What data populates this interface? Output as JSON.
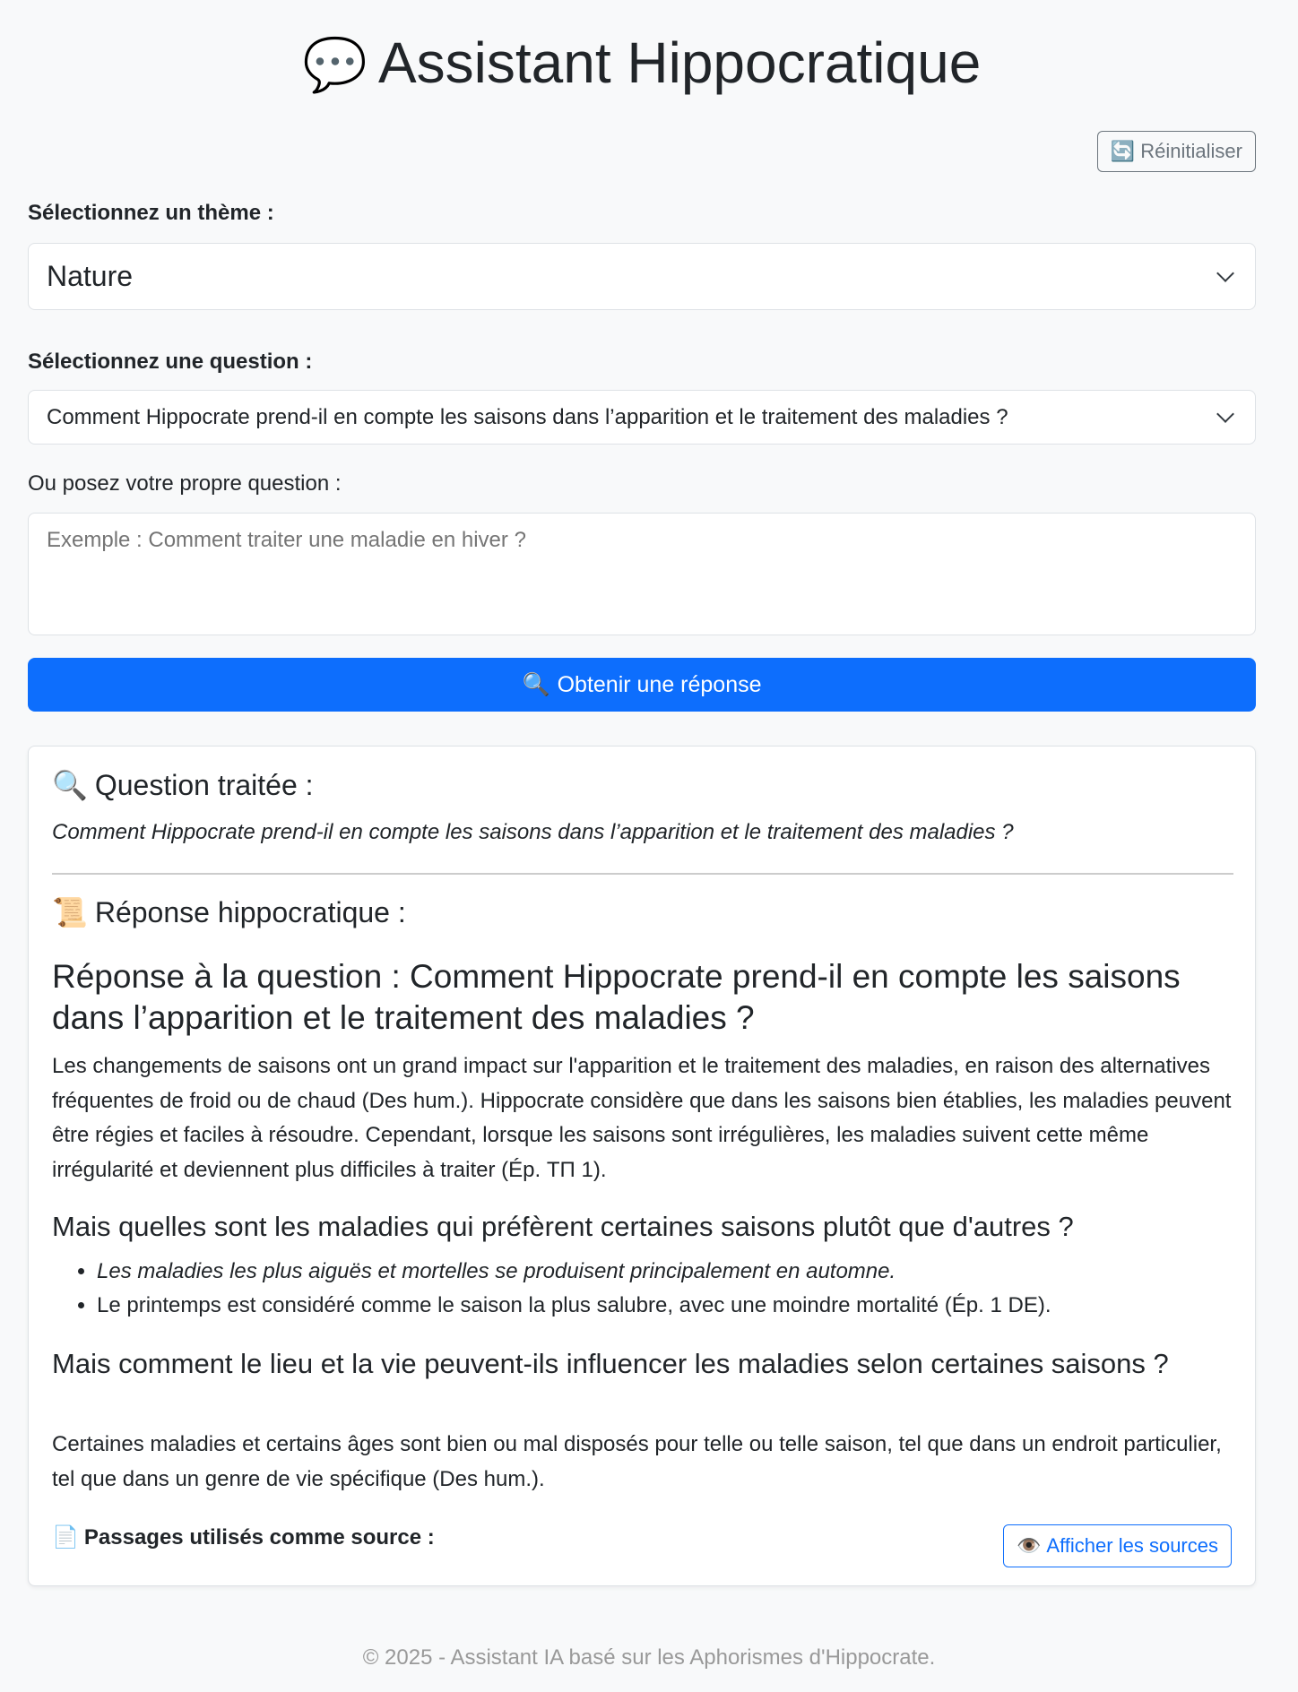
{
  "header": {
    "title_icon": "💬",
    "title": "Assistant Hippocratique",
    "reset_icon": "🔄",
    "reset_label": "Réinitialiser"
  },
  "form": {
    "theme_label": "Sélectionnez un thème :",
    "theme_selected": "Nature",
    "question_label": "Sélectionnez une question :",
    "question_selected": "Comment Hippocrate prend-il en compte les saisons dans l’apparition et le traitement des maladies ?",
    "custom_label": "Ou posez votre propre question :",
    "custom_placeholder": "Exemple : Comment traiter une maladie en hiver ?",
    "submit_icon": "🔍",
    "submit_label": "Obtenir une réponse"
  },
  "result": {
    "question_icon": "🔍",
    "question_heading": "Question traitée :",
    "question_text": "Comment Hippocrate prend-il en compte les saisons dans l’apparition et le traitement des maladies ?",
    "response_icon": "📜",
    "response_heading": "Réponse hippocratique :",
    "answer_title": "Réponse à la question : Comment Hippocrate prend-il en compte les saisons dans l’apparition et le traitement des maladies ?",
    "answer_paragraph_1": "Les changements de saisons ont un grand impact sur l'apparition et le traitement des maladies, en raison des alternatives fréquentes de froid ou de chaud (Des hum.). Hippocrate considère que dans les saisons bien établies, les maladies peuvent être régies et faciles à résoudre. Cependant, lorsque les saisons sont irrégulières, les maladies suivent cette même irrégularité et deviennent plus difficiles à traiter (Ép. ΤΠ 1).",
    "subheading_1": "Mais quelles sont les maladies qui préfèrent certaines saisons plutôt que d'autres ?",
    "list_item_1": "Les maladies les plus aiguës et mortelles se produisent principalement en automne.",
    "list_item_2": "Le printemps est considéré comme le saison la plus salubre, avec une moindre mortalité (Ép. 1 DE).",
    "subheading_2": "Mais comment le lieu et la vie peuvent-ils influencer les maladies selon certaines saisons ?",
    "answer_paragraph_2": "Certaines maladies et certains âges sont bien ou mal disposés pour telle ou telle saison, tel que dans un endroit particulier, tel que dans un genre de vie spécifique (Des hum.).",
    "sources_icon": "📄",
    "sources_label": "Passages utilisés comme source :",
    "show_sources_icon": "👁️",
    "show_sources_label": "Afficher les sources"
  },
  "footer": {
    "text": "© 2025 - Assistant IA basé sur les Aphorismes d'Hippocrate."
  },
  "colors": {
    "primary": "#0d6efd",
    "secondary": "#6c757d",
    "background": "#f8f9fa"
  }
}
